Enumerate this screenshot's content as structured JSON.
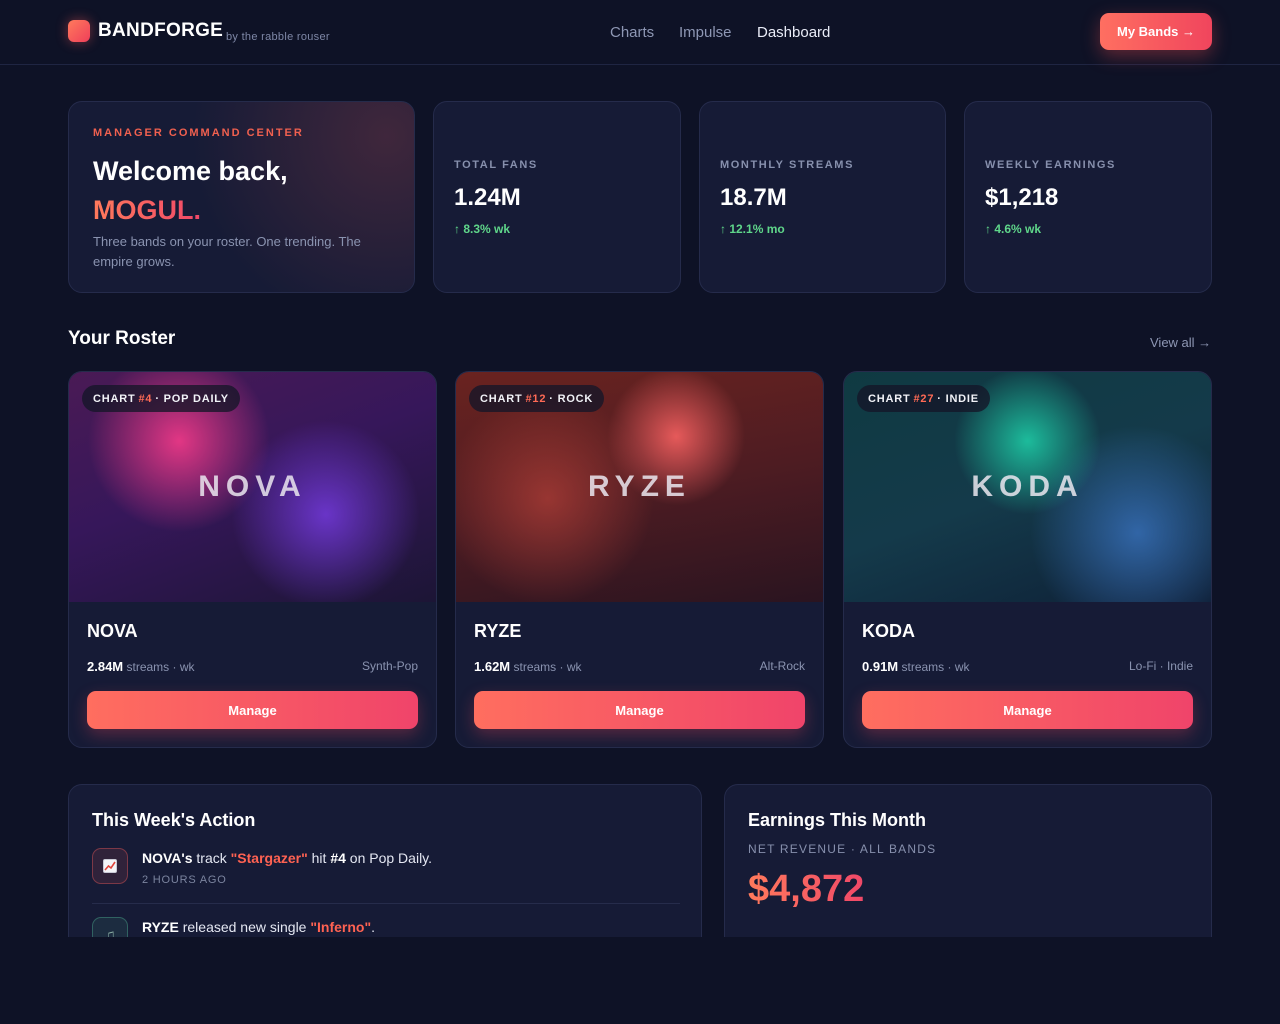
{
  "brand": {
    "name": "BANDFORGE",
    "tagline": "by the rabble rouser"
  },
  "nav": {
    "items": [
      "Charts",
      "Impulse",
      "Dashboard"
    ],
    "active": "Dashboard",
    "cta": "My Bands →"
  },
  "welcome": {
    "eyebrow": "MANAGER COMMAND CENTER",
    "greeting": "Welcome back,",
    "name": "MOGUL.",
    "message": "Three bands on your roster. One trending. The empire grows."
  },
  "stats": [
    {
      "label": "TOTAL FANS",
      "value": "1.24M",
      "delta": "↑ 8.3% wk"
    },
    {
      "label": "MONTHLY STREAMS",
      "value": "18.7M",
      "delta": "↑ 12.1% mo"
    },
    {
      "label": "WEEKLY EARNINGS",
      "value": "$1,218",
      "delta": "↑ 4.6% wk"
    }
  ],
  "roster": {
    "title": "Your Roster",
    "view_all": "View all →",
    "bands": [
      {
        "name": "NOVA",
        "chart_prefix": "CHART",
        "rank": "#4",
        "chart_suffix": "· POP DAILY",
        "streams": "2.84M",
        "streams_unit": "streams · wk",
        "genre": "Synth-Pop",
        "manage": "Manage"
      },
      {
        "name": "RYZE",
        "chart_prefix": "CHART",
        "rank": "#12",
        "chart_suffix": "· ROCK",
        "streams": "1.62M",
        "streams_unit": "streams · wk",
        "genre": "Alt-Rock",
        "manage": "Manage"
      },
      {
        "name": "KODA",
        "chart_prefix": "CHART",
        "rank": "#27",
        "chart_suffix": "· INDIE",
        "streams": "0.91M",
        "streams_unit": "streams · wk",
        "genre": "Lo-Fi · Indie",
        "manage": "Manage"
      }
    ]
  },
  "activity": {
    "title": "This Week's Action",
    "items": [
      {
        "icon": "chart-up-icon",
        "band": "NOVA's",
        "text1": "track",
        "track": "\"Stargazer\"",
        "text2": "hit",
        "rank": "#4",
        "text3": "on Pop Daily.",
        "time": "2 HOURS AGO"
      },
      {
        "icon": "music-note-icon",
        "band": "RYZE",
        "text1": "released new single",
        "track": "\"Inferno\"",
        "text2": "."
      }
    ]
  },
  "earnings": {
    "title": "Earnings This Month",
    "subtitle": "NET REVENUE · ALL BANDS",
    "amount": "$4,872"
  },
  "colors": {
    "accent": "#ff6a55",
    "background": "#0e1226",
    "panel": "#161b36",
    "positive": "#5fd68a"
  }
}
